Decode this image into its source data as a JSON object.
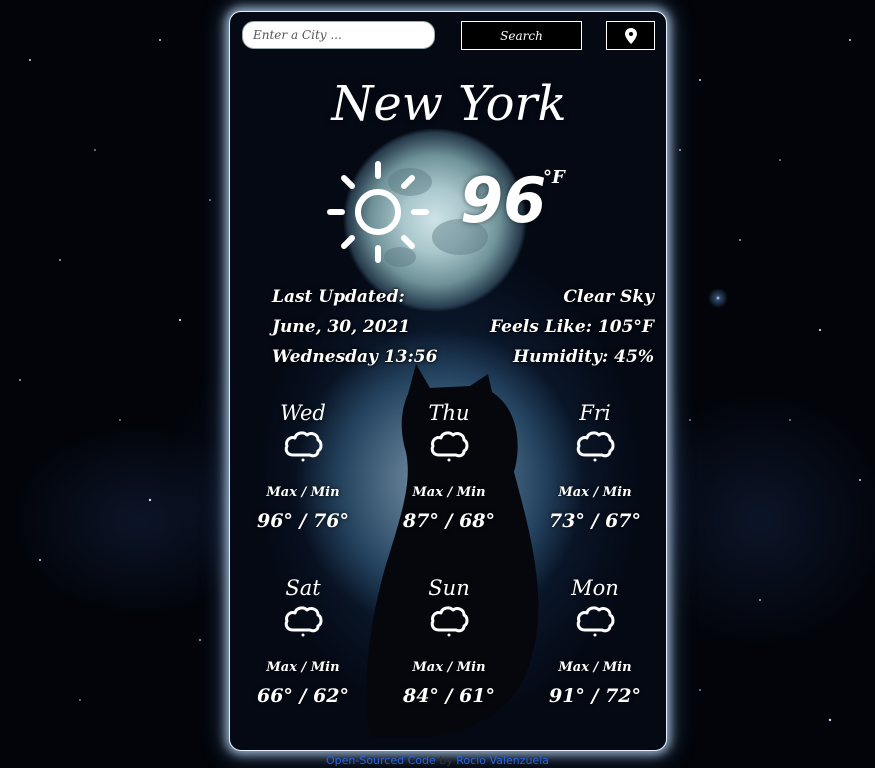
{
  "search": {
    "placeholder": "Enter a City ...",
    "button_label": "Search"
  },
  "location_button": {
    "icon": "map-pin-icon"
  },
  "current": {
    "city": "New York",
    "icon": "sun-icon",
    "temperature": "96",
    "unit": "°F",
    "last_updated_label": "Last Updated:",
    "date": "June, 30, 2021",
    "day_time": "Wednesday 13:56",
    "condition": "Clear Sky",
    "feels_like": "Feels Like: 105°F",
    "humidity": "Humidity: 45%"
  },
  "forecast": [
    {
      "day": "Wed",
      "icon": "cloud-icon",
      "label": "Max / Min",
      "temps": "96° / 76°"
    },
    {
      "day": "Thu",
      "icon": "cloud-icon",
      "label": "Max / Min",
      "temps": "87° / 68°"
    },
    {
      "day": "Fri",
      "icon": "cloud-icon",
      "label": "Max / Min",
      "temps": "73° / 67°"
    },
    {
      "day": "Sat",
      "icon": "cloud-icon",
      "label": "Max / Min",
      "temps": "66° / 62°"
    },
    {
      "day": "Sun",
      "icon": "cloud-icon",
      "label": "Max / Min",
      "temps": "84° / 61°"
    },
    {
      "day": "Mon",
      "icon": "cloud-icon",
      "label": "Max / Min",
      "temps": "91° / 72°"
    }
  ],
  "footer": {
    "link_text": "Open-Sourced Code",
    "by_text": "by",
    "author": "Rocio Valenzuela"
  },
  "colors": {
    "accent": "#ffffff",
    "link": "#2a63e0",
    "background": "#02040a"
  }
}
